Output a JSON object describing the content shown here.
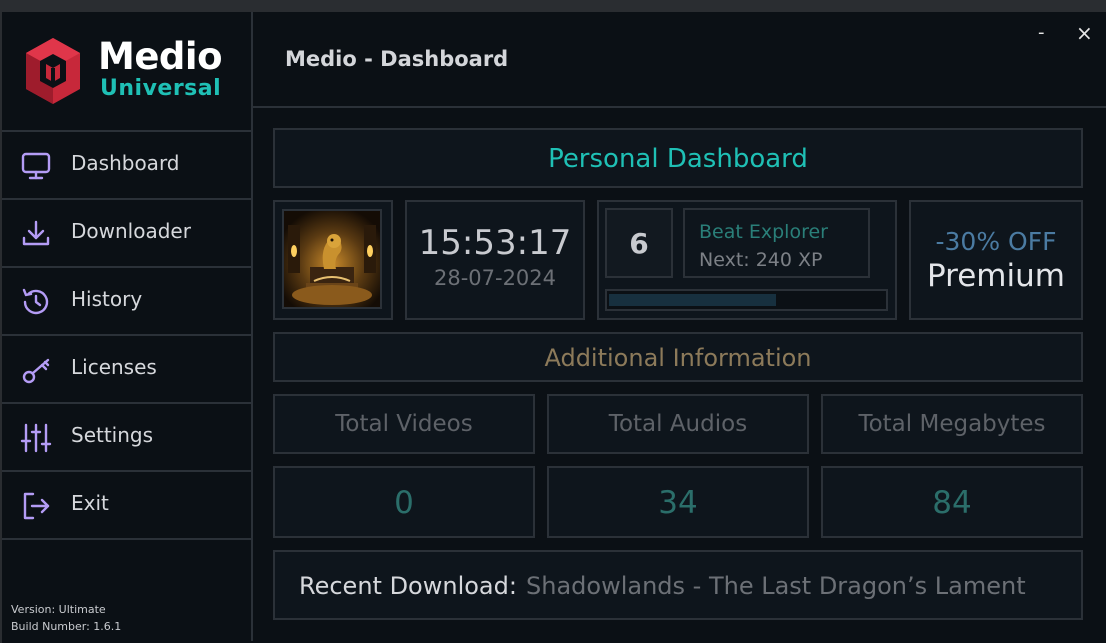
{
  "app": {
    "logo_title": "Medio",
    "logo_subtitle": "Universal",
    "window_title": "Medio - Dashboard",
    "minimize_label": "-",
    "close_label": "×"
  },
  "sidebar": {
    "items": [
      {
        "label": "Dashboard",
        "icon": "monitor-icon"
      },
      {
        "label": "Downloader",
        "icon": "download-icon"
      },
      {
        "label": "History",
        "icon": "history-icon"
      },
      {
        "label": "Licenses",
        "icon": "key-icon"
      },
      {
        "label": "Settings",
        "icon": "sliders-icon"
      },
      {
        "label": "Exit",
        "icon": "exit-icon"
      }
    ],
    "version": "Version: Ultimate",
    "build": "Build Number: 1.6.1"
  },
  "dashboard": {
    "title": "Personal Dashboard",
    "time": "15:53:17",
    "date": "28-07-2024",
    "level": "6",
    "rank": "Beat Explorer",
    "next_xp": "Next: 240 XP",
    "xp_progress": 0.6,
    "promo_discount": "-30% OFF",
    "promo_name": "Premium"
  },
  "info": {
    "title": "Additional Information",
    "stats": [
      {
        "label": "Total Videos",
        "value": "0"
      },
      {
        "label": "Total Audios",
        "value": "34"
      },
      {
        "label": "Total Megabytes",
        "value": "84"
      }
    ],
    "recent_label": "Recent Download:",
    "recent_value": "Shadowlands - The Last Dragon’s Lament"
  },
  "colors": {
    "accent_teal": "#1fc0b5",
    "logo_red": "#c7283a",
    "icon_purple": "#b49cf5",
    "info_title": "#8c7a5a",
    "promo_blue": "#4b7ba2"
  }
}
